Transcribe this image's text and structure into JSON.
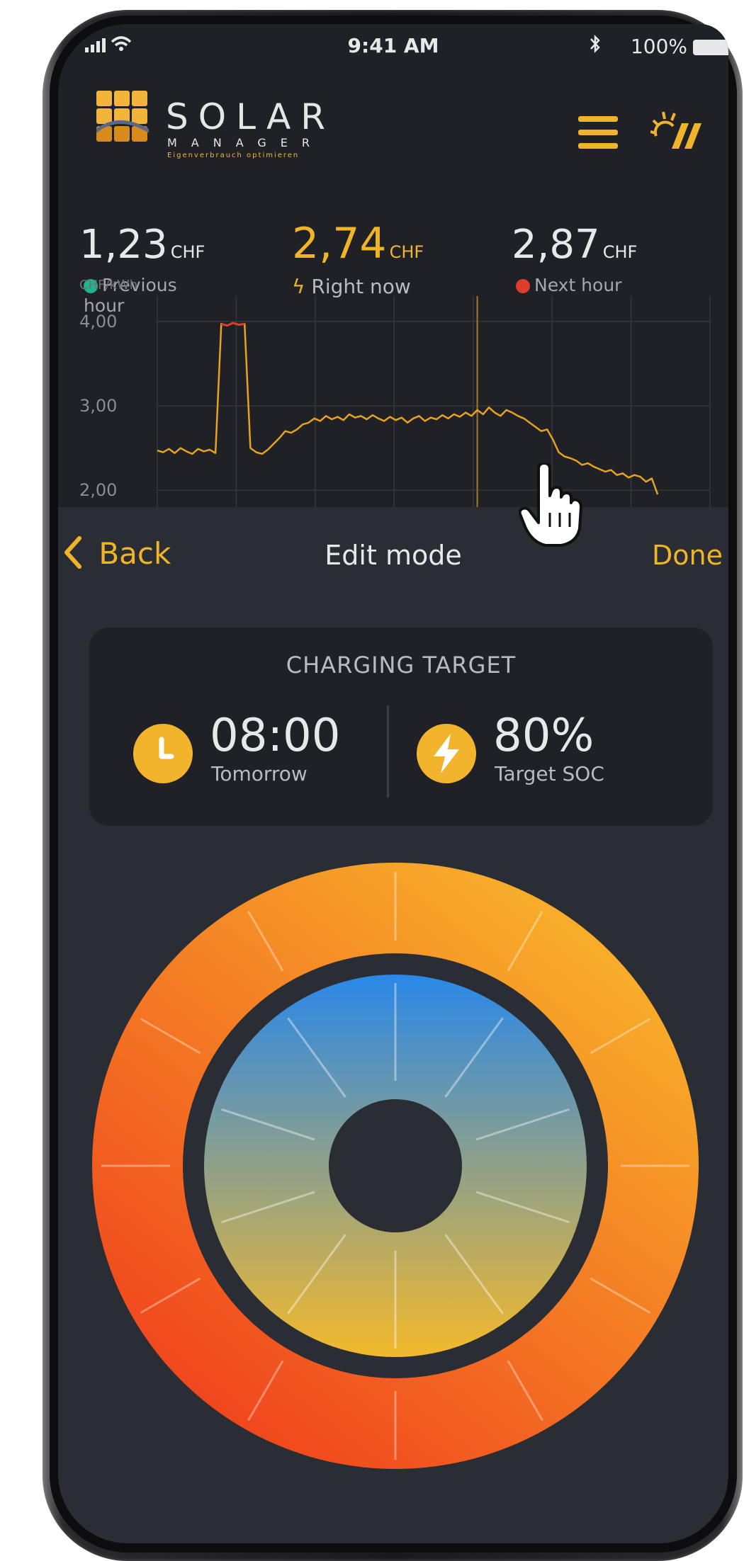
{
  "status_bar": {
    "time": "9:41 AM",
    "battery": "100%",
    "bluetooth_icon": "bluetooth-icon",
    "wifi_icon": "wifi-icon",
    "signal_icon": "signal-icon"
  },
  "header": {
    "logo_title": "SOLAR",
    "logo_subtitle": "MANAGER",
    "logo_tagline": "Eigenverbrauch optimieren",
    "menu_icon": "hamburger-menu-icon",
    "brand_icon": "sun-stripes-icon"
  },
  "prices": [
    {
      "value": "1,23",
      "unit": "CHF",
      "label": "Previous hour",
      "indicator": "teal-check-dot"
    },
    {
      "value": "2,74",
      "unit": "CHF",
      "label": "Right now",
      "indicator": "lightning-icon"
    },
    {
      "value": "2,87",
      "unit": "CHF",
      "label": "Next hour",
      "indicator": "red-up-dot"
    }
  ],
  "colors": {
    "accent": "#f0b429",
    "background": "#2a2d33",
    "card": "#1f2126",
    "teal": "#21b38b",
    "red": "#e03c2c",
    "line": "#e7a21f"
  },
  "chart_data": {
    "type": "line",
    "ylabel": "CHF/kWh",
    "ytick_labels": [
      "4,00",
      "3,00",
      "2,00"
    ],
    "ylim": [
      1.8,
      4.3
    ],
    "grid": true,
    "x": [
      0,
      1,
      2,
      3,
      4,
      5,
      6,
      7,
      8,
      9,
      10,
      11,
      12,
      13,
      14,
      15,
      16,
      17,
      18,
      19,
      20,
      21,
      22,
      23,
      24,
      25,
      26,
      27,
      28,
      29,
      30,
      31,
      32,
      33,
      34,
      35,
      36,
      37,
      38,
      39,
      40,
      41,
      42,
      43,
      44,
      45,
      46,
      47,
      48,
      49,
      50,
      51,
      52,
      53,
      54,
      55,
      56,
      57,
      58,
      59,
      60,
      61,
      62,
      63,
      64,
      65,
      66,
      67,
      68,
      69,
      70,
      71,
      72,
      73,
      74,
      75,
      76,
      77,
      78,
      79,
      80,
      81,
      82,
      83,
      84,
      85,
      86,
      87,
      88,
      89,
      90,
      91,
      92,
      93,
      94,
      95
    ],
    "y": [
      2.47,
      2.45,
      2.49,
      2.44,
      2.5,
      2.46,
      2.43,
      2.49,
      2.46,
      2.48,
      2.44,
      3.97,
      3.95,
      3.98,
      3.96,
      3.97,
      2.5,
      2.45,
      2.43,
      2.48,
      2.55,
      2.62,
      2.7,
      2.68,
      2.72,
      2.78,
      2.8,
      2.85,
      2.82,
      2.88,
      2.84,
      2.87,
      2.83,
      2.9,
      2.86,
      2.88,
      2.84,
      2.89,
      2.85,
      2.82,
      2.87,
      2.83,
      2.86,
      2.8,
      2.85,
      2.88,
      2.82,
      2.86,
      2.84,
      2.89,
      2.85,
      2.9,
      2.87,
      2.92,
      2.88,
      2.95,
      2.9,
      2.98,
      2.92,
      2.88,
      2.95,
      2.92,
      2.88,
      2.85,
      2.8,
      2.75,
      2.7,
      2.72,
      2.6,
      2.45,
      2.4,
      2.38,
      2.35,
      2.3,
      2.32,
      2.28,
      2.25,
      2.22,
      2.24,
      2.18,
      2.2,
      2.15,
      2.18,
      2.16,
      2.1,
      2.14,
      1.95
    ],
    "now_index": 55
  },
  "edit_bar": {
    "back_label": "Back",
    "title": "Edit mode",
    "done_label": "Done"
  },
  "charging_target": {
    "title": "CHARGING TARGET",
    "time": "08:00",
    "time_label": "Tomorrow",
    "soc": "80%",
    "soc_label": "Target SOC",
    "clock_icon": "clock-icon",
    "bolt_icon": "lightning-icon"
  },
  "wheel": {
    "outer_colors": [
      "#f7b52a",
      "#f04a1f"
    ],
    "inner_colors": [
      "#2a8ae8",
      "#f2b82c"
    ]
  }
}
